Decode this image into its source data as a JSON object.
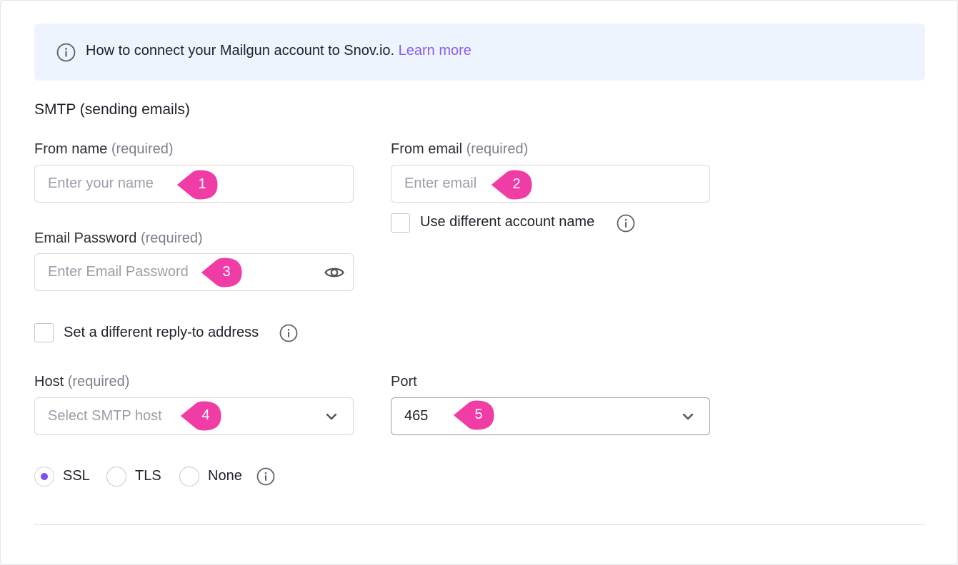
{
  "banner": {
    "text": "How to connect your Mailgun account to Snov.io.",
    "link": "Learn more"
  },
  "section_title": "SMTP (sending emails)",
  "required_tag": "(required)",
  "from_name": {
    "label": "From name",
    "placeholder": "Enter your name"
  },
  "from_email": {
    "label": "From email",
    "placeholder": "Enter email"
  },
  "use_different_account": {
    "label": "Use different account name",
    "checked": false
  },
  "email_password": {
    "label": "Email Password",
    "placeholder": "Enter Email Password"
  },
  "reply_to": {
    "label": "Set a different reply-to address",
    "checked": false
  },
  "host": {
    "label": "Host",
    "placeholder": "Select SMTP host"
  },
  "port": {
    "label": "Port",
    "value": "465"
  },
  "security": {
    "options": [
      "SSL",
      "TLS",
      "None"
    ],
    "selected": "SSL"
  },
  "markers": [
    "1",
    "2",
    "3",
    "4",
    "5"
  ],
  "colors": {
    "accent": "#8a5cf0",
    "radio_selected": "#7c4ff0",
    "marker": "#f03da6",
    "banner_bg": "#eef4fd"
  },
  "icons": {
    "banner": "info-icon",
    "password_toggle": "eye-icon",
    "dropdown": "chevron-down-icon"
  }
}
